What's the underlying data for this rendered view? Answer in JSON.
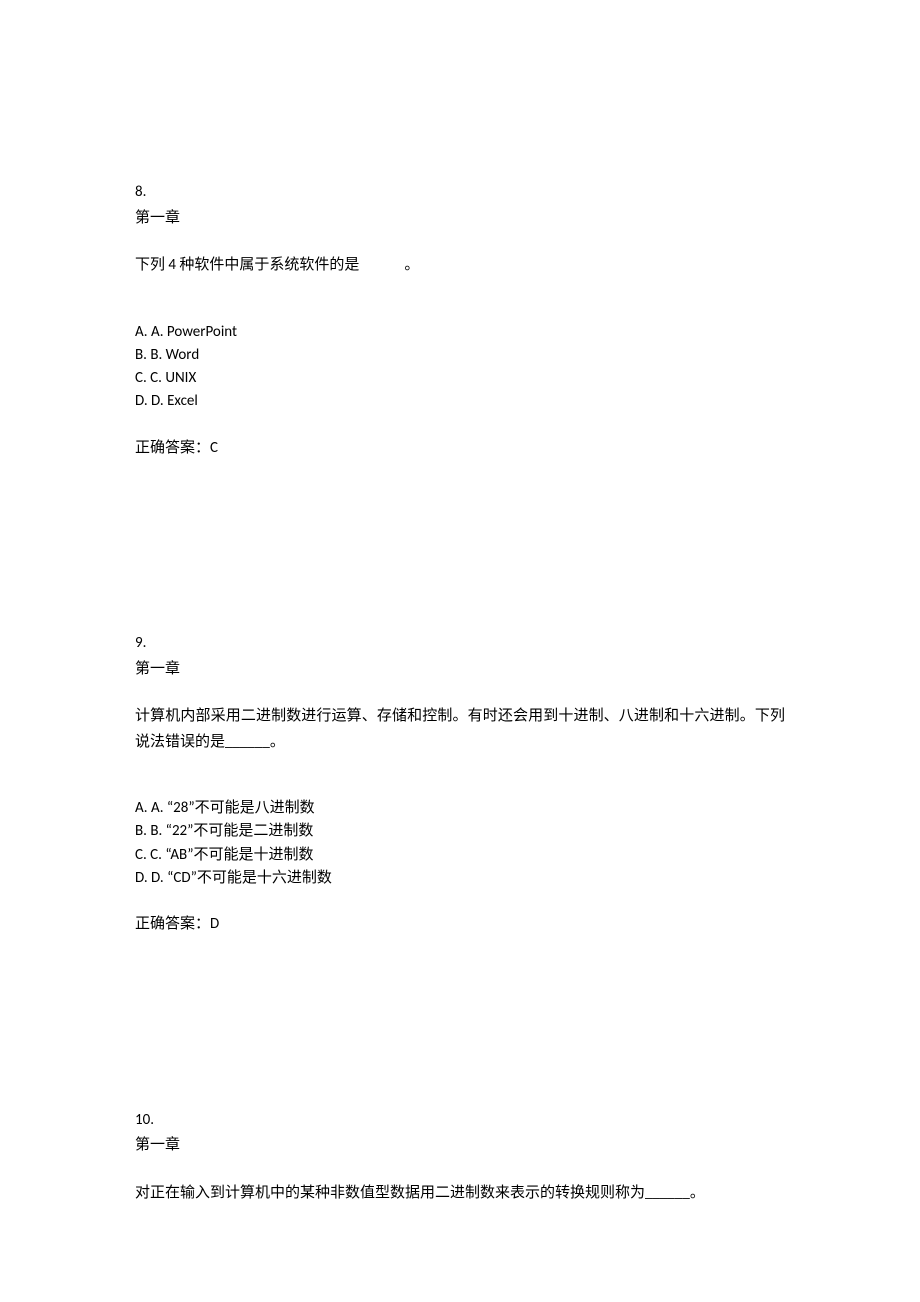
{
  "questions": [
    {
      "number": "8.",
      "chapter": "第一章",
      "text": "下列 4 种软件中属于系统软件的是　　　。",
      "options": [
        "A. A. PowerPoint",
        "B. B. Word",
        "C. C. UNIX",
        "D. D. Excel"
      ],
      "answer": "正确答案：C"
    },
    {
      "number": "9.",
      "chapter": "第一章",
      "text": "计算机内部采用二进制数进行运算、存储和控制。有时还会用到十进制、八进制和十六进制。下列说法错误的是______。",
      "options": [
        "A. A. “28”不可能是八进制数",
        "B. B. “22”不可能是二进制数",
        "C. C. “AB”不可能是十进制数",
        "D. D. “CD”不可能是十六进制数"
      ],
      "answer": "正确答案：D"
    },
    {
      "number": "10.",
      "chapter": "第一章",
      "text": "对正在输入到计算机中的某种非数值型数据用二进制数来表示的转换规则称为______。",
      "options": [],
      "answer": ""
    }
  ]
}
